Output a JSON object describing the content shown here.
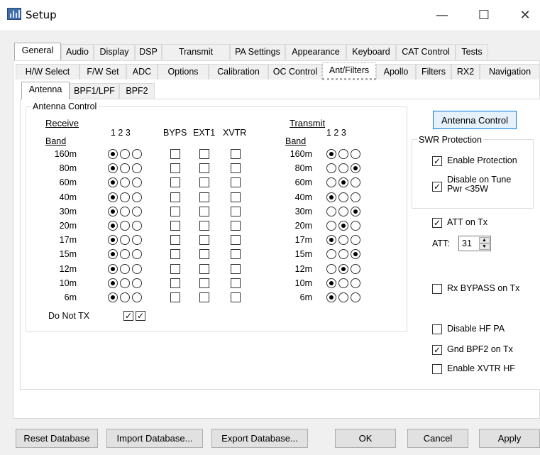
{
  "window": {
    "title": "Setup",
    "minimize": "—",
    "maximize": "☐",
    "close": "✕"
  },
  "main_tabs": [
    "General",
    "Audio",
    "Display",
    "DSP",
    "Transmit",
    "PA Settings",
    "Appearance",
    "Keyboard",
    "CAT Control",
    "Tests"
  ],
  "sub_tabs": [
    "H/W Select",
    "F/W Set",
    "ADC",
    "Options",
    "Calibration",
    "OC Control",
    "Ant/Filters",
    "Apollo",
    "Filters",
    "RX2",
    "Navigation"
  ],
  "ant_tabs": [
    "Antenna",
    "BPF1/LPF",
    "BPF2"
  ],
  "antenna_control": {
    "group_title": "Antenna Control",
    "receive_label": "Receive",
    "transmit_label": "Transmit",
    "band_label": "Band",
    "col_123": "1  2  3",
    "col_byps": "BYPS",
    "col_ext1": "EXT1",
    "col_xvtr": "XVTR",
    "do_not_tx": "Do Not TX",
    "do_not_tx_checks": [
      true,
      true
    ],
    "bands": [
      "160m",
      "80m",
      "60m",
      "40m",
      "30m",
      "20m",
      "17m",
      "15m",
      "12m",
      "10m",
      "6m"
    ],
    "rx_selected": [
      1,
      1,
      1,
      1,
      1,
      1,
      1,
      1,
      1,
      1,
      1
    ],
    "byps": [
      false,
      false,
      false,
      false,
      false,
      false,
      false,
      false,
      false,
      false,
      false
    ],
    "ext1": [
      false,
      false,
      false,
      false,
      false,
      false,
      false,
      false,
      false,
      false,
      false
    ],
    "xvtr": [
      false,
      false,
      false,
      false,
      false,
      false,
      false,
      false,
      false,
      false,
      false
    ],
    "tx_selected": [
      1,
      3,
      2,
      1,
      3,
      2,
      1,
      3,
      2,
      1,
      1
    ]
  },
  "right": {
    "antenna_control_button": "Antenna Control",
    "swr_title": "SWR Protection",
    "enable_protection": {
      "label": "Enable Protection",
      "checked": true
    },
    "disable_on_tune": {
      "label_line1": "Disable on Tune",
      "label_line2": "Pwr <35W",
      "checked": true
    },
    "att_on_tx": {
      "label": "ATT on Tx",
      "checked": true
    },
    "att_label": "ATT:",
    "att_value": "31",
    "rx_bypass": {
      "label": "Rx BYPASS on Tx",
      "checked": false
    },
    "disable_hf_pa": {
      "label": "Disable HF PA",
      "checked": false
    },
    "gnd_bpf2": {
      "label": "Gnd BPF2 on Tx",
      "checked": true
    },
    "enable_xvtr_hf": {
      "label": "Enable XVTR HF",
      "checked": false
    }
  },
  "footer": {
    "reset": "Reset Database",
    "import": "Import Database...",
    "export": "Export Database...",
    "ok": "OK",
    "cancel": "Cancel",
    "apply": "Apply"
  }
}
